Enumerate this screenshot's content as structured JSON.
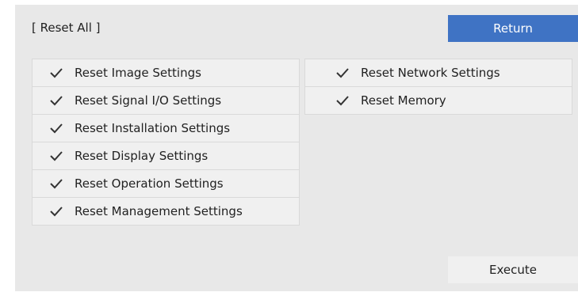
{
  "title": "[ Reset All ]",
  "return_label": "Return",
  "execute_label": "Execute",
  "left_items": [
    {
      "label": "Reset Image Settings",
      "checked": true
    },
    {
      "label": "Reset Signal I/O Settings",
      "checked": true
    },
    {
      "label": "Reset Installation Settings",
      "checked": true
    },
    {
      "label": "Reset Display Settings",
      "checked": true
    },
    {
      "label": "Reset Operation Settings",
      "checked": true
    },
    {
      "label": "Reset Management Settings",
      "checked": true
    }
  ],
  "right_items": [
    {
      "label": "Reset Network Settings",
      "checked": true
    },
    {
      "label": "Reset Memory",
      "checked": true
    }
  ],
  "colors": {
    "accent": "#3f73c4",
    "panel": "#e8e8e8",
    "item": "#f0f0f0"
  }
}
